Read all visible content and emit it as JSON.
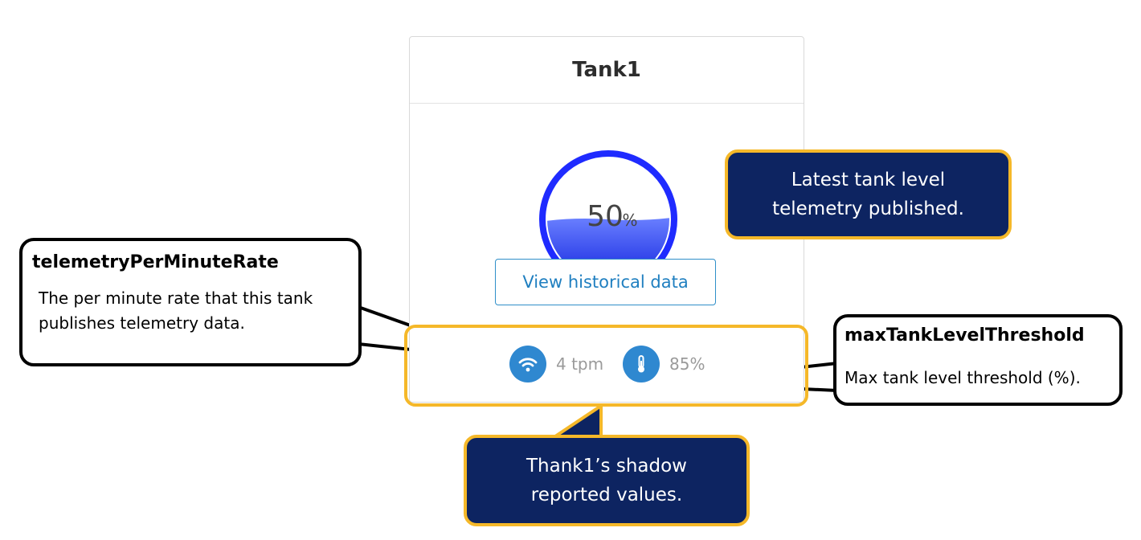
{
  "card": {
    "title": "Tank1",
    "tank_level": {
      "value": "50",
      "unit": "%",
      "fill_fraction": 0.5
    },
    "history_button_label": "View historical data",
    "telemetry_rate": {
      "icon": "wifi-icon",
      "value": "4 tpm"
    },
    "max_threshold": {
      "icon": "thermometer-icon",
      "value": "85%"
    }
  },
  "annotations": {
    "tank_level_note": {
      "line1": "Latest tank level",
      "line2": "telemetry published."
    },
    "shadow_note": {
      "line1": "Thank1’s shadow",
      "line2": "reported values."
    },
    "rate_note": {
      "heading": "telemetryPerMinuteRate",
      "body": "The per minute rate that this tank publishes telemetry data."
    },
    "threshold_note": {
      "heading": "maxTankLevelThreshold",
      "body": "Max tank level threshold (%)."
    }
  },
  "colors": {
    "callout_fill": "#0d2461",
    "callout_border": "#f5b829",
    "gauge_blue": "#1f2bff",
    "icon_blue": "#2f88d0",
    "link_blue": "#1f7fc0"
  }
}
